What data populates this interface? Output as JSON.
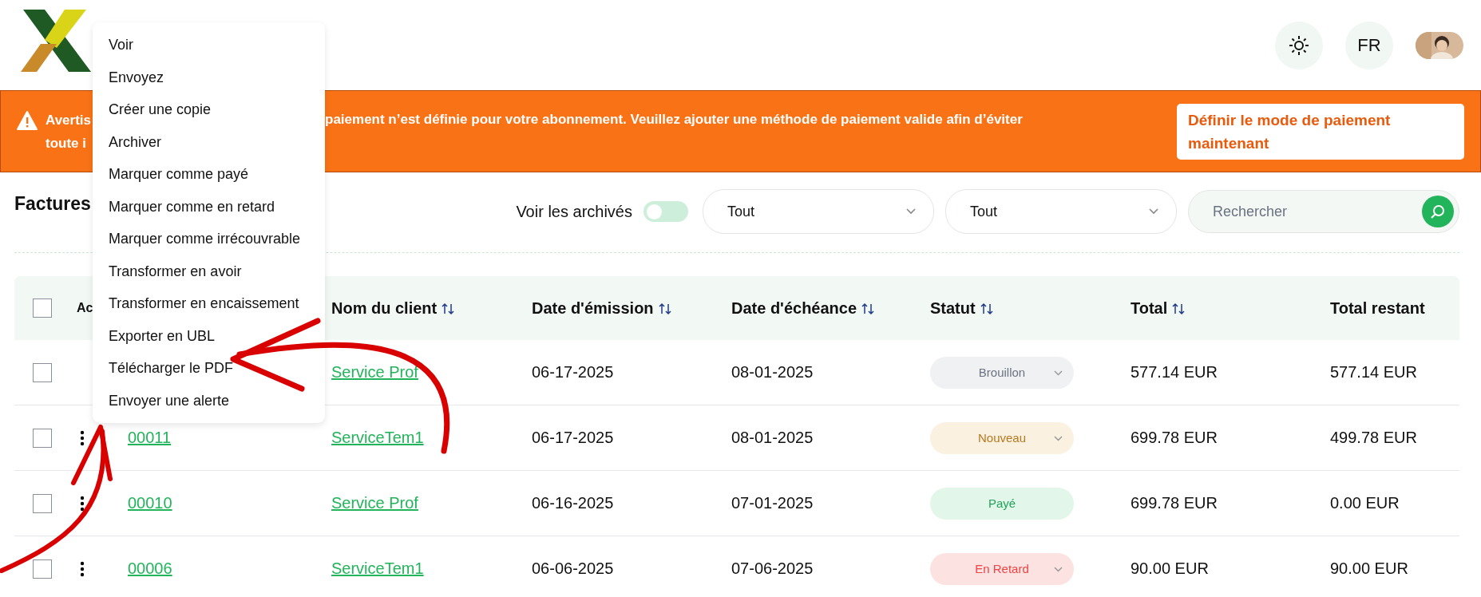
{
  "header": {
    "language": "FR"
  },
  "banner": {
    "text_left": [
      "Avertis",
      "toute i"
    ],
    "text_right": "paiement n’est définie pour votre abonnement. Veuillez ajouter une méthode de paiement valide afin d’éviter",
    "button": "Définir le mode de paiement maintenant"
  },
  "toolbar": {
    "title": "Factures",
    "archived_label": "Voir les archivés",
    "archived_on": false,
    "filters": [
      {
        "value": "Tout"
      },
      {
        "value": "Tout"
      }
    ],
    "search": {
      "placeholder": "Rechercher"
    }
  },
  "table": {
    "columns": [
      {
        "label": "Ac",
        "sortable": false
      },
      {
        "label": "Nom du client",
        "sortable": true
      },
      {
        "label": "Date d'émission",
        "sortable": true
      },
      {
        "label": "Date d'échéance",
        "sortable": true
      },
      {
        "label": "Statut",
        "sortable": true
      },
      {
        "label": "Total",
        "sortable": true
      },
      {
        "label": "Total restant",
        "sortable": false
      }
    ],
    "all_checked": false,
    "rows": [
      {
        "checked": false,
        "number": "",
        "client": "Service Prof",
        "issued": "06-17-2025",
        "due": "08-01-2025",
        "status": "Brouillon",
        "color": "#f0f1f3",
        "dropdown": true,
        "total": "577.14 EUR",
        "remaining": "577.14 EUR"
      },
      {
        "checked": false,
        "number": "00011",
        "client": "ServiceTem1",
        "issued": "06-17-2025",
        "due": "08-01-2025",
        "status": "Nouveau",
        "color": "#fbf1e0",
        "dropdown": true,
        "total": "699.78 EUR",
        "remaining": "499.78 EUR"
      },
      {
        "checked": false,
        "number": "00010",
        "client": "Service Prof",
        "issued": "06-16-2025",
        "due": "07-01-2025",
        "status": "Payé",
        "color": "#e3f6ea",
        "dropdown": false,
        "total": "699.78 EUR",
        "remaining": "0.00 EUR"
      },
      {
        "checked": false,
        "number": "00006",
        "client": "ServiceTem1",
        "issued": "06-06-2025",
        "due": "07-06-2025",
        "status": "En Retard",
        "color": "#fde2e2",
        "dropdown": true,
        "total": "90.00 EUR",
        "remaining": "90.00 EUR"
      }
    ]
  },
  "menu": {
    "items": [
      "Voir",
      "Envoyez",
      "Créer une copie",
      "Archiver",
      "Marquer comme payé",
      "Marquer comme en retard",
      "Marquer comme irrécouvrable",
      "Transformer en avoir",
      "Transformer en encaissement",
      "Exporter en UBL",
      "Télécharger le PDF",
      "Envoyer une alerte"
    ]
  }
}
